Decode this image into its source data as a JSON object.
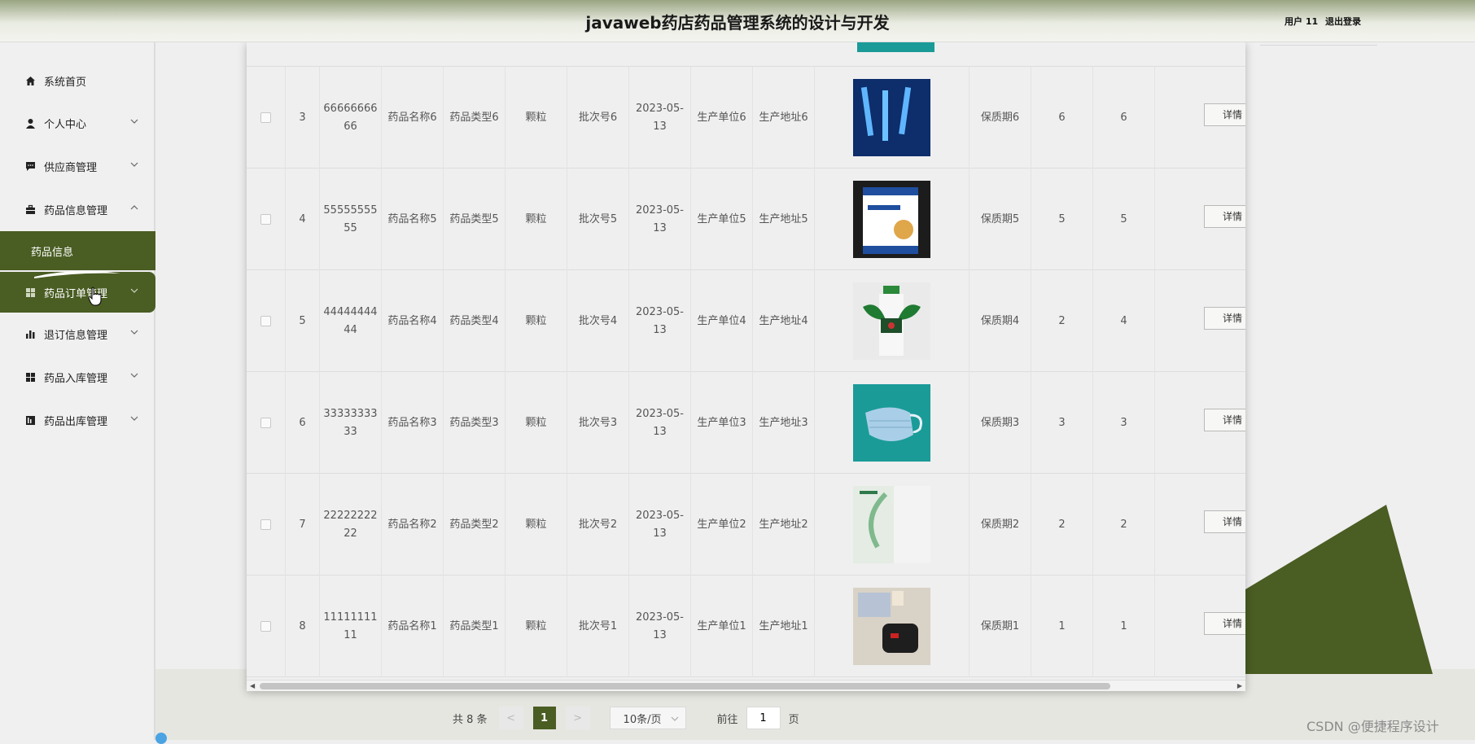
{
  "header": {
    "title": "javaweb药店药品管理系统的设计与开发",
    "user": "用户 11",
    "logout": "退出登录"
  },
  "sidebar": {
    "items": [
      {
        "label": "系统首页",
        "icon": "home-icon"
      },
      {
        "label": "个人中心",
        "icon": "user-icon"
      },
      {
        "label": "供应商管理",
        "icon": "chat-icon"
      },
      {
        "label": "药品信息管理",
        "icon": "briefcase-icon"
      },
      {
        "label": "药品订单管理",
        "icon": "grid-icon"
      },
      {
        "label": "退订信息管理",
        "icon": "bar-chart-icon"
      },
      {
        "label": "药品入库管理",
        "icon": "grid-icon"
      },
      {
        "label": "药品出库管理",
        "icon": "chart-icon"
      }
    ],
    "submenu": {
      "label": "药品信息"
    }
  },
  "table": {
    "rows": [
      {
        "index": "3",
        "code": "6666666666",
        "name": "药品名称6",
        "type": "药品类型6",
        "form": "颗粒",
        "batch": "批次号6",
        "date": "2023-05-13",
        "unit": "生产单位6",
        "address": "生产地址6",
        "shelf": "保质期6",
        "qty1": "6",
        "qty2": "6",
        "detail": "详情"
      },
      {
        "index": "4",
        "code": "5555555555",
        "name": "药品名称5",
        "type": "药品类型5",
        "form": "颗粒",
        "batch": "批次号5",
        "date": "2023-05-13",
        "unit": "生产单位5",
        "address": "生产地址5",
        "shelf": "保质期5",
        "qty1": "5",
        "qty2": "5",
        "detail": "详情"
      },
      {
        "index": "5",
        "code": "4444444444",
        "name": "药品名称4",
        "type": "药品类型4",
        "form": "颗粒",
        "batch": "批次号4",
        "date": "2023-05-13",
        "unit": "生产单位4",
        "address": "生产地址4",
        "shelf": "保质期4",
        "qty1": "2",
        "qty2": "4",
        "detail": "详情"
      },
      {
        "index": "6",
        "code": "3333333333",
        "name": "药品名称3",
        "type": "药品类型3",
        "form": "颗粒",
        "batch": "批次号3",
        "date": "2023-05-13",
        "unit": "生产单位3",
        "address": "生产地址3",
        "shelf": "保质期3",
        "qty1": "3",
        "qty2": "3",
        "detail": "详情"
      },
      {
        "index": "7",
        "code": "2222222222",
        "name": "药品名称2",
        "type": "药品类型2",
        "form": "颗粒",
        "batch": "批次号2",
        "date": "2023-05-13",
        "unit": "生产单位2",
        "address": "生产地址2",
        "shelf": "保质期2",
        "qty1": "2",
        "qty2": "2",
        "detail": "详情"
      },
      {
        "index": "8",
        "code": "1111111111",
        "name": "药品名称1",
        "type": "药品类型1",
        "form": "颗粒",
        "batch": "批次号1",
        "date": "2023-05-13",
        "unit": "生产单位1",
        "address": "生产地址1",
        "shelf": "保质期1",
        "qty1": "1",
        "qty2": "1",
        "detail": "详情"
      }
    ]
  },
  "pagination": {
    "total": "共 8 条",
    "prev": "<",
    "page": "1",
    "next": ">",
    "page_size": "10条/页",
    "goto_prefix": "前往",
    "goto_value": "1",
    "goto_suffix": "页"
  },
  "watermark": "CSDN @便捷程序设计",
  "colors": {
    "accent": "#4a5d23",
    "teal": "#1a9b98"
  }
}
